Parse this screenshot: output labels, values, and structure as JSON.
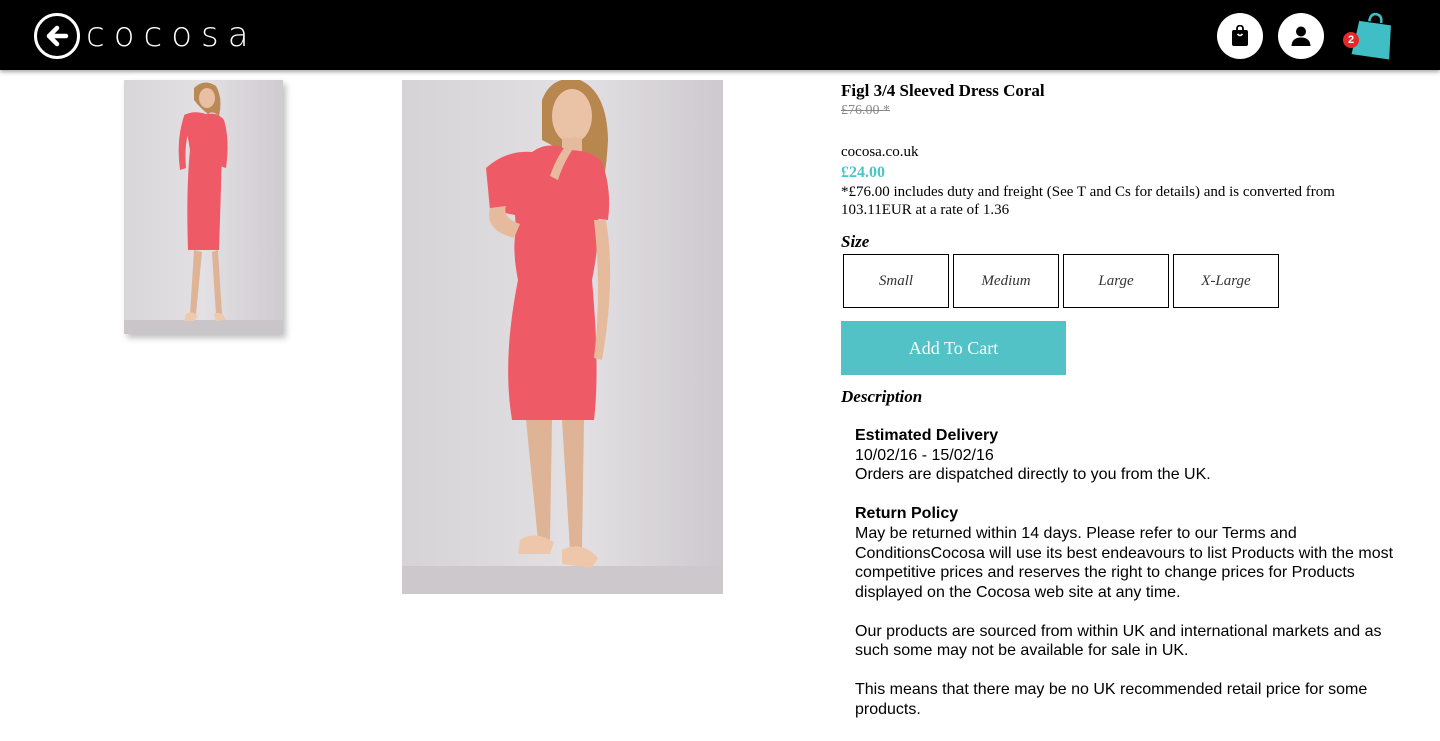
{
  "header": {
    "logo_text": "cocosa",
    "cart_count": "2",
    "icons": [
      "back-arrow-icon",
      "shopping-bag-icon",
      "user-icon",
      "cart-bag-icon"
    ],
    "accent_color": "#52c2c6"
  },
  "product": {
    "title": "Figl 3/4 Sleeved Dress Coral",
    "old_price": "£76.00 *",
    "store": "cocosa.co.uk",
    "price": "£24.00",
    "price_note": "*£76.00 includes duty and freight (See T and Cs for details) and is converted from 103.11EUR at a rate of 1.36",
    "size_label": "Size",
    "sizes": [
      "Small",
      "Medium",
      "Large",
      "X-Large"
    ],
    "add_to_cart": "Add To Cart",
    "description_label": "Description"
  },
  "description": {
    "delivery_heading": "Estimated Delivery",
    "delivery_dates": "10/02/16 - 15/02/16",
    "delivery_note": "Orders are dispatched directly to you from the UK.",
    "return_heading": "Return Policy",
    "return_text": "May be returned within 14 days. Please refer to our Terms and ConditionsCocosa will use its best endeavours to list Products with the most competitive prices and reserves the right to change prices for Products displayed on the Cocosa web site at any time.",
    "sourcing_text": "Our products are sourced from within UK and international markets and as such some may not be available for sale in UK.",
    "rrp_text": "This means that there may be no UK recommended retail price for some products."
  }
}
